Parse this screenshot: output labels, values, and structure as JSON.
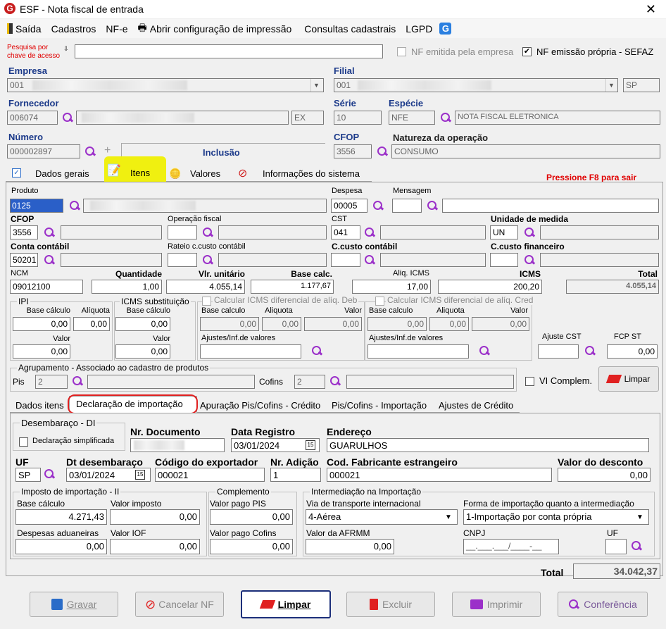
{
  "window": {
    "title": "ESF - Nota fiscal de entrada"
  },
  "menu": {
    "saida": "Saída",
    "cadastros": "Cadastros",
    "nfe": "NF-e",
    "impressao": "Abrir configuração de impressão",
    "consultas": "Consultas cadastrais",
    "lgpd": "LGPD"
  },
  "header": {
    "pesquisa_label_1": "Pesquisa por",
    "pesquisa_label_2": "chave de acesso",
    "nf_emitida": "NF emitida pela empresa",
    "nf_propria": "NF emissão própria - SEFAZ",
    "empresa_label": "Empresa",
    "empresa_code": "001",
    "filial_label": "Filial",
    "filial_code": "001",
    "filial_uf": "SP",
    "fornecedor_label": "Fornecedor",
    "fornecedor_code": "006074",
    "fornecedor_uf": "EX",
    "serie_label": "Série",
    "serie": "10",
    "especie_label": "Espécie",
    "especie": "NFE",
    "especie_desc": "NOTA FISCAL ELETRONICA",
    "numero_label": "Número",
    "numero": "000002897",
    "inclusao": "Inclusão",
    "cfop_label": "CFOP",
    "cfop": "3556",
    "natureza_label": "Natureza da operação",
    "natureza": "CONSUMO"
  },
  "tabs": {
    "dados_gerais": "Dados gerais",
    "itens": "Itens",
    "valores": "Valores",
    "info": "Informações do sistema",
    "f8": "Pressione F8 para sair"
  },
  "item": {
    "produto_label": "Produto",
    "produto": "0125",
    "despesa_label": "Despesa",
    "despesa": "00005",
    "mensagem_label": "Mensagem",
    "cfop_label": "CFOP",
    "cfop": "3556",
    "opfiscal_label": "Operação fiscal",
    "cst_label": "CST",
    "cst": "041",
    "unidade_label": "Unidade de medida",
    "unidade": "UN",
    "conta_label": "Conta contábil",
    "conta": "50201",
    "rateio_label": "Rateio c.custo contábil",
    "ccusto_label": "C.custo contábil",
    "ccfin_label": "C.custo financeiro",
    "ncm_label": "NCM",
    "ncm": "09012100",
    "qtd_label": "Quantidade",
    "qtd": "1,00",
    "vunit_label": "Vlr. unitário",
    "vunit": "4.055,14",
    "base_label": "Base calc.",
    "base": "1.177,67",
    "aliq_label": "Aliq. ICMS",
    "aliq": "17,00",
    "icms_label": "ICMS",
    "icms": "200,20",
    "total_label": "Total",
    "total": "4.055,14"
  },
  "ipi": {
    "title": "IPI",
    "base_label": "Base cálculo",
    "base": "0,00",
    "aliq_label": "Alíquota",
    "aliq": "0,00",
    "valor_label": "Valor",
    "valor": "0,00"
  },
  "icmsst": {
    "title": "ICMS substituição",
    "base_label": "Base cálculo",
    "base": "0,00",
    "valor_label": "Valor",
    "valor": "0,00"
  },
  "difdeb": {
    "title": "Calcular ICMS diferencial de alíq. Deb",
    "base_label": "Base calculo",
    "base": "0,00",
    "aliq_label": "Aliquota",
    "aliq": "0,00",
    "valor_label": "Valor",
    "valor": "0,00",
    "ajustes_label": "Ajustes/Inf.de valores"
  },
  "difcred": {
    "title": "Calcular ICMS diferencial de alíq. Cred",
    "base_label": "Base calculo",
    "base": "0,00",
    "aliq_label": "Aliquota",
    "aliq": "0,00",
    "valor_label": "Valor",
    "valor": "0,00",
    "ajustes_label": "Ajustes/Inf.de valores"
  },
  "ajustecst_label": "Ajuste CST",
  "fcpst": {
    "label": "FCP ST",
    "value": "0,00"
  },
  "agrup": {
    "title": "Agrupamento - Associado ao cadastro de produtos",
    "pis_label": "Pis",
    "pis": "2",
    "cofins_label": "Cofins",
    "cofins": "2",
    "vicomplem": "VI Complem.",
    "limpar": "Limpar"
  },
  "subtabs": {
    "dados": "Dados itens",
    "decl": "Declaração de importação",
    "apur": "Apuração Pis/Cofins - Crédito",
    "piscof": "Pis/Cofins - Importação",
    "ajustes": "Ajustes de Crédito"
  },
  "di": {
    "title": "Desembaraço - DI",
    "simplificada": "Declaração simplificada",
    "nrdoc_label": "Nr. Documento",
    "datareg_label": "Data Registro",
    "datareg": "03/01/2024",
    "endereco_label": "Endereço",
    "endereco": "GUARULHOS",
    "uf_label": "UF",
    "uf": "SP",
    "dtdes_label": "Dt desembaraço",
    "dtdes": "03/01/2024",
    "codexp_label": "Código do exportador",
    "codexp": "000021",
    "nradicao_label": "Nr. Adição",
    "nradicao": "1",
    "codfab_label": "Cod. Fabricante estrangeiro",
    "codfab": "000021",
    "desconto_label": "Valor do desconto",
    "desconto": "0,00"
  },
  "ii": {
    "title": "Imposto de importação - II",
    "base_label": "Base cálculo",
    "base": "4.271,43",
    "vimp_label": "Valor imposto",
    "vimp": "0,00",
    "desp_label": "Despesas aduaneiras",
    "desp": "0,00",
    "iof_label": "Valor IOF",
    "iof": "0,00"
  },
  "compl": {
    "title": "Complemento",
    "pis_label": "Valor pago PIS",
    "pis": "0,00",
    "cofins_label": "Valor pago Cofins",
    "cofins": "0,00"
  },
  "inter": {
    "title": "Intermediação na Importação",
    "via_label": "Via de transporte internacional",
    "via": "4-Aérea",
    "forma_label": "Forma de importação quanto a intermediação",
    "forma": "1-Importação por conta própria",
    "afrmm_label": "Valor da AFRMM",
    "afrmm": "0,00",
    "cnpj_label": "CNPJ",
    "cnpj": "__.___.___/____-__",
    "uf_label": "UF"
  },
  "footer": {
    "total_label": "Total",
    "total": "34.042,37"
  },
  "buttons": {
    "gravar": "Gravar",
    "cancelar": "Cancelar NF",
    "limpar": "Limpar",
    "excluir": "Excluir",
    "imprimir": "Imprimir",
    "conferencia": "Conferência"
  }
}
